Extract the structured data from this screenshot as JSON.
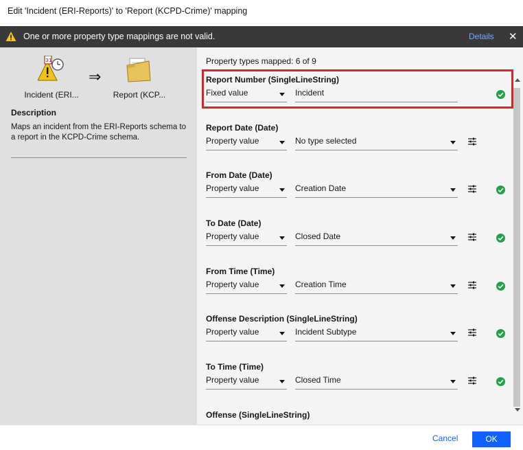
{
  "dialog": {
    "title": "Edit 'Incident (ERI-Reports)' to 'Report (KCPD-Crime)' mapping"
  },
  "warning": {
    "icon": "warning-triangle-icon",
    "message": "One or more property type mappings are not valid.",
    "details_label": "Details",
    "close_label": "✕"
  },
  "left": {
    "source_label": "Incident (ERI...",
    "target_label": "Report (KCP...",
    "arrow": "⇒",
    "description_title": "Description",
    "description_text": "Maps an incident from the ERI-Reports schema to a report in the KCPD-Crime schema."
  },
  "right": {
    "mapped_count": "Property types mapped: 6 of 9",
    "properties": [
      {
        "name": "Report Number (SingleLineString)",
        "mode": "Fixed value",
        "value": "Incident",
        "value_is_text": true,
        "has_settings": false,
        "valid": true
      },
      {
        "name": "Report Date (Date)",
        "mode": "Property value",
        "value": "No type selected",
        "value_is_text": false,
        "has_settings": true,
        "valid": false
      },
      {
        "name": "From Date (Date)",
        "mode": "Property value",
        "value": "Creation Date",
        "value_is_text": false,
        "has_settings": true,
        "valid": true
      },
      {
        "name": "To Date (Date)",
        "mode": "Property value",
        "value": "Closed Date",
        "value_is_text": false,
        "has_settings": true,
        "valid": true
      },
      {
        "name": "From Time (Time)",
        "mode": "Property value",
        "value": "Creation Time",
        "value_is_text": false,
        "has_settings": true,
        "valid": true
      },
      {
        "name": "Offense Description (SingleLineString)",
        "mode": "Property value",
        "value": "Incident Subtype",
        "value_is_text": false,
        "has_settings": true,
        "valid": true
      },
      {
        "name": "To Time (Time)",
        "mode": "Property value",
        "value": "Closed Time",
        "value_is_text": false,
        "has_settings": true,
        "valid": true
      },
      {
        "name": "Offense (SingleLineString)",
        "mode": "",
        "value": "",
        "value_is_text": false,
        "has_settings": false,
        "valid": false
      }
    ]
  },
  "footer": {
    "cancel_label": "Cancel",
    "ok_label": "OK"
  },
  "colors": {
    "accent": "#0f62fe",
    "valid": "#24a148",
    "warning": "#f1c21b",
    "highlight": "#e0202a"
  }
}
